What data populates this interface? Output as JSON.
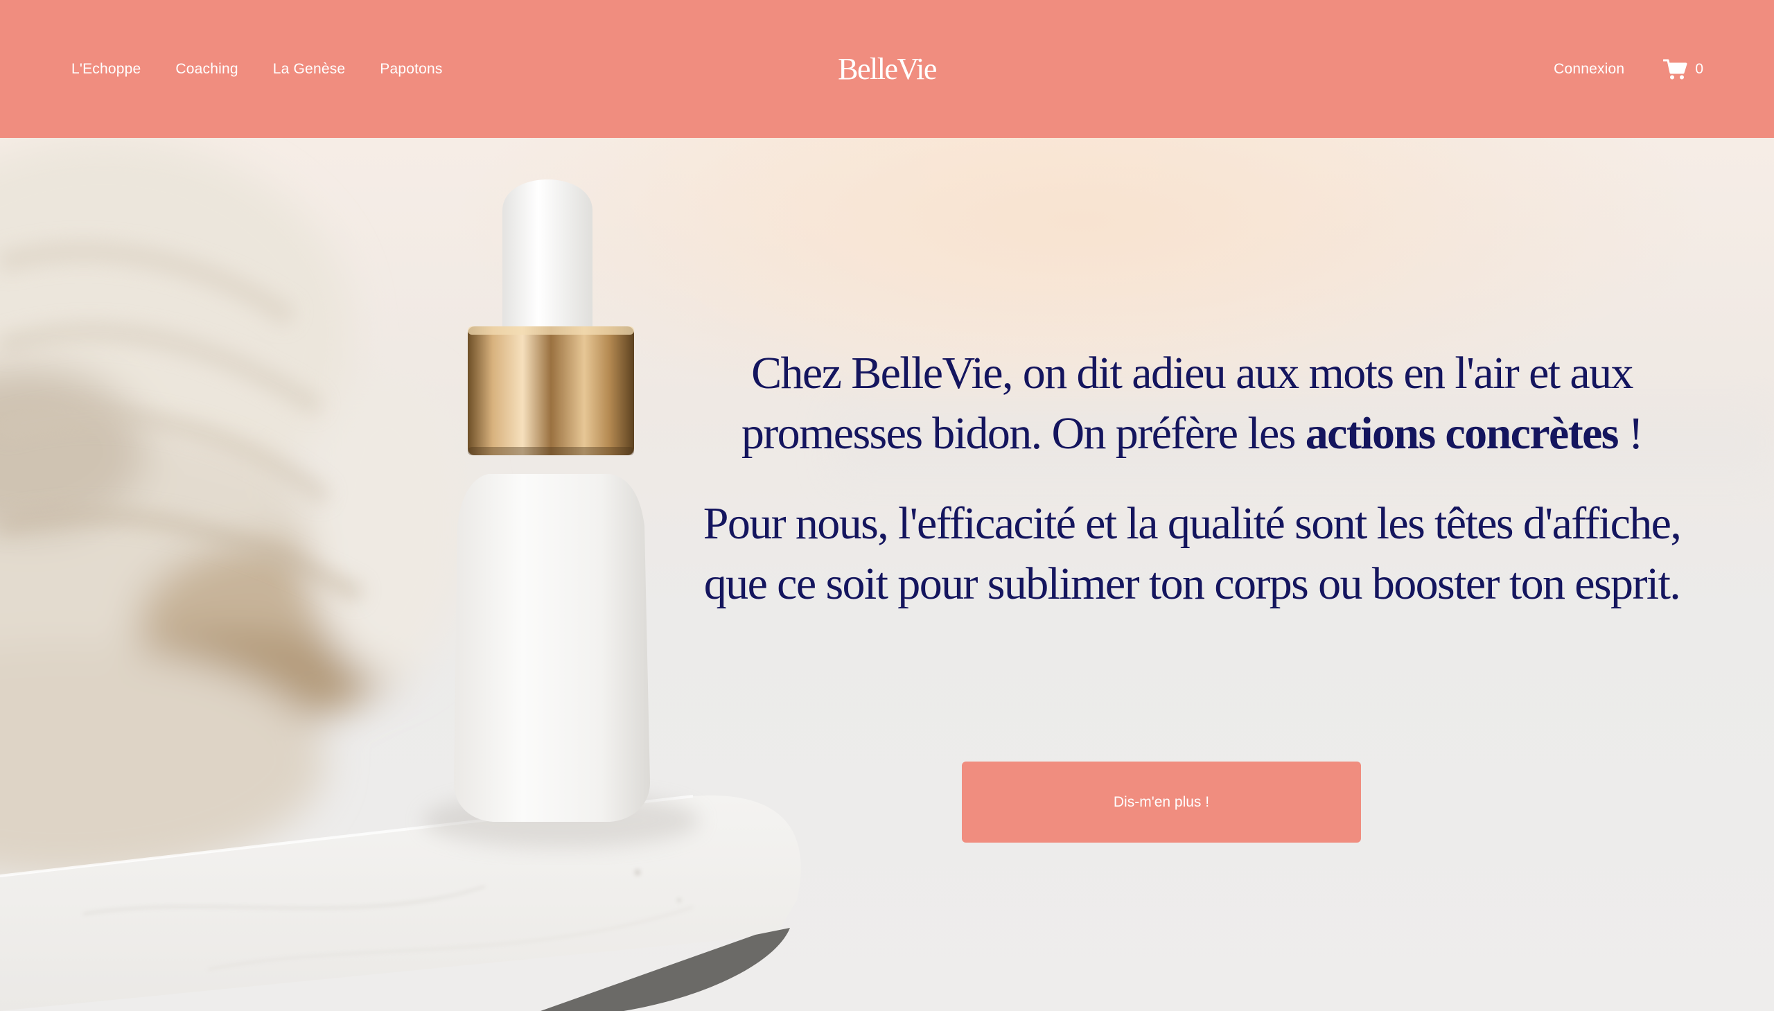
{
  "header": {
    "nav": [
      {
        "label": "L'Echoppe"
      },
      {
        "label": "Coaching"
      },
      {
        "label": "La Genèse"
      },
      {
        "label": "Papotons"
      }
    ],
    "brand": "BelleVie",
    "login_label": "Connexion",
    "cart_icon": "cart-icon",
    "cart_count": "0"
  },
  "hero": {
    "line1_part1": "Chez BelleVie, on dit adieu aux mots en l'air et aux promesses bidon. On préfère les ",
    "line1_strong": "actions concrètes",
    "line1_part2": " !",
    "line2": "Pour nous, l'efficacité et la qualité sont les têtes d'affiche, que ce soit pour sublimer ton corps ou booster ton esprit.",
    "cta_label": "Dis-m'en plus !"
  },
  "colors": {
    "header_bg": "#f08d7f",
    "accent": "#f08d7f",
    "text_navy": "#14155e",
    "header_text": "#ffffff"
  }
}
